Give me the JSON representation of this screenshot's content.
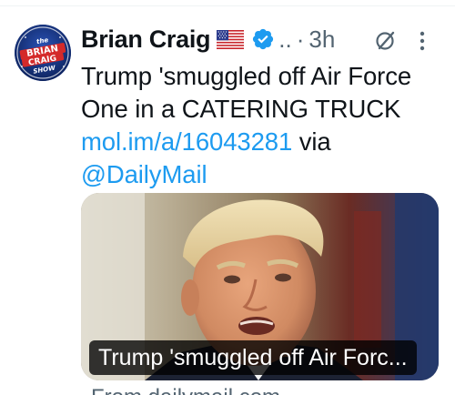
{
  "author": {
    "display_name": "Brian Craig",
    "handle_truncated": "..",
    "separator": "·",
    "time": "3h",
    "avatar_lines": [
      "the",
      "BRIAN",
      "CRAIG",
      "SHOW"
    ]
  },
  "icons": {
    "flag": "us-flag-icon",
    "verified": "verified-badge-icon",
    "grok": "grok-icon",
    "more": "more-options-icon"
  },
  "tweet": {
    "text_line1": "Trump 'smuggled off Air Force",
    "text_line2": "One in a CATERING TRUCK",
    "link": "mol.im/a/16043281",
    "via": " via",
    "mention": "@DailyMail"
  },
  "card": {
    "caption": "Trump 'smuggled off Air Forc...",
    "source": "From dailymail.com"
  },
  "colors": {
    "link": "#1d9bf0",
    "verified": "#1d9bf0",
    "secondary_text": "#536471",
    "primary_text": "#0f1419"
  }
}
